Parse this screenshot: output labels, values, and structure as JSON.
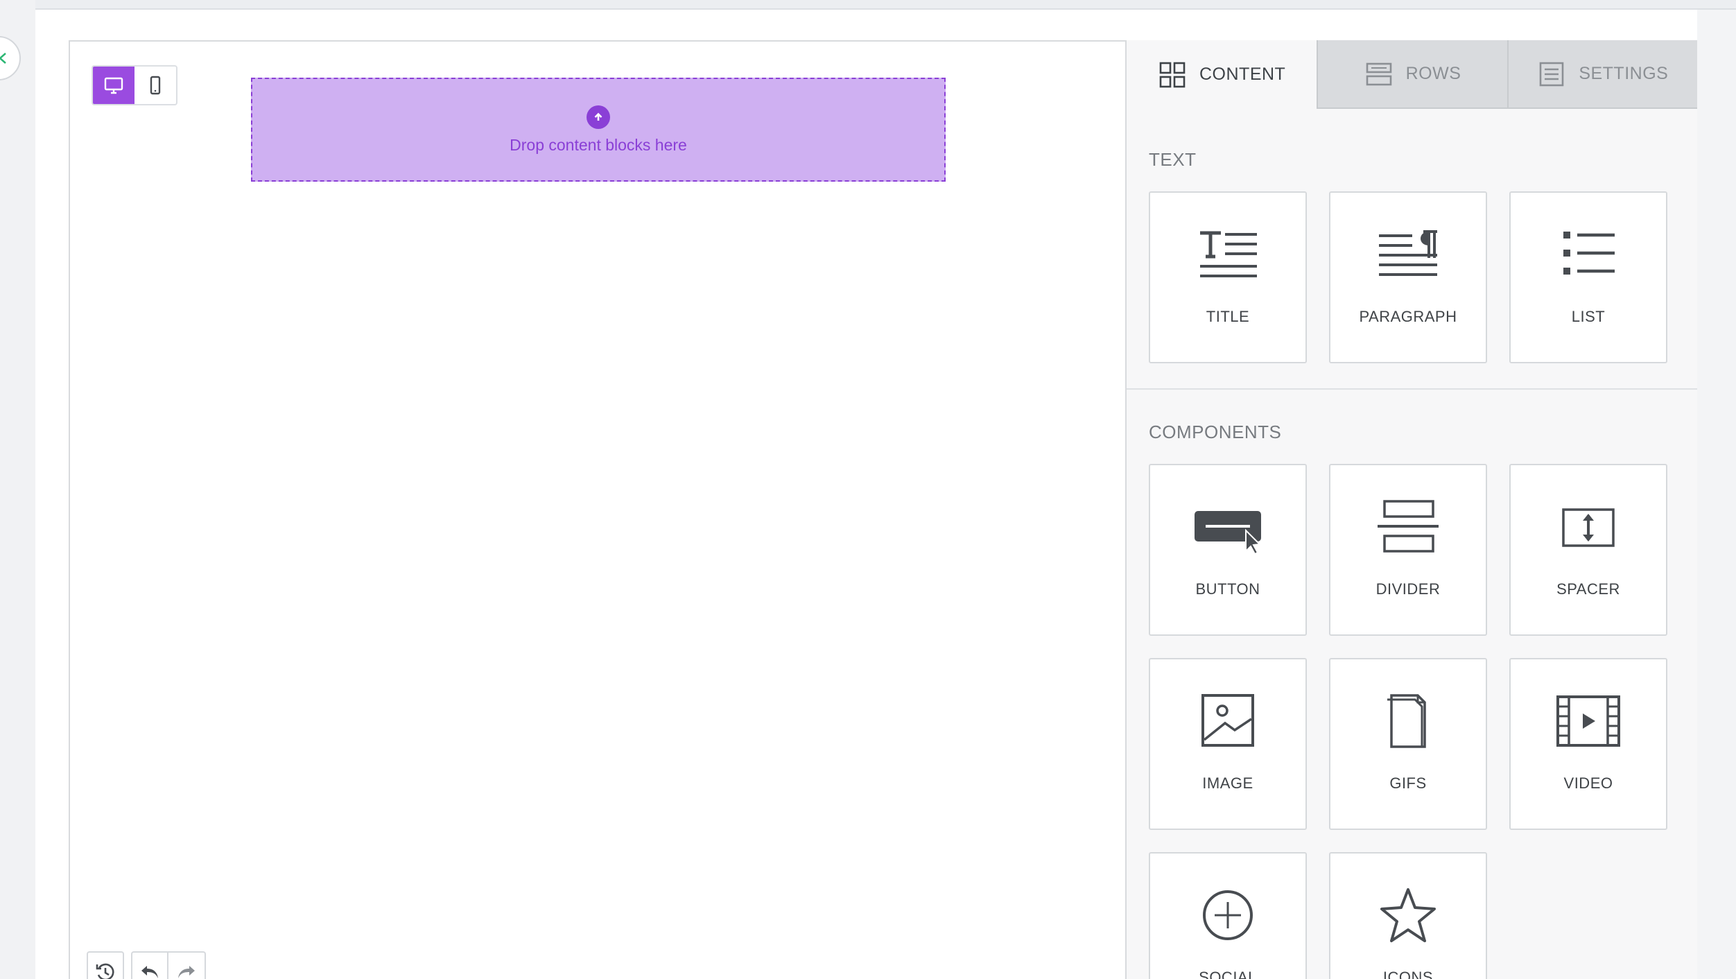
{
  "colors": {
    "accent": "#9a4be0",
    "dropzone_bg": "#cfb0f2",
    "dropzone_text": "#8a3fd6",
    "icon_dark": "#484c51"
  },
  "device_toggle": {
    "desktop_icon": "desktop-icon",
    "mobile_icon": "mobile-icon",
    "active": "desktop"
  },
  "dropzone": {
    "icon": "upload-arrow-icon",
    "text": "Drop content blocks here"
  },
  "history": {
    "history_icon": "history-icon",
    "undo_icon": "undo-icon",
    "redo_icon": "redo-icon"
  },
  "sidebar": {
    "tabs": [
      {
        "label": "CONTENT",
        "icon": "grid-icon",
        "active": true
      },
      {
        "label": "ROWS",
        "icon": "rows-icon",
        "active": false
      },
      {
        "label": "SETTINGS",
        "icon": "settings-icon",
        "active": false
      }
    ],
    "text_section": {
      "title": "TEXT",
      "blocks": [
        {
          "label": "TITLE",
          "icon": "title-icon"
        },
        {
          "label": "PARAGRAPH",
          "icon": "paragraph-icon"
        },
        {
          "label": "LIST",
          "icon": "list-icon"
        }
      ]
    },
    "components_section": {
      "title": "COMPONENTS",
      "blocks": [
        {
          "label": "BUTTON",
          "icon": "button-icon"
        },
        {
          "label": "DIVIDER",
          "icon": "divider-icon"
        },
        {
          "label": "SPACER",
          "icon": "spacer-icon"
        },
        {
          "label": "IMAGE",
          "icon": "image-icon"
        },
        {
          "label": "GIFS",
          "icon": "gifs-icon"
        },
        {
          "label": "VIDEO",
          "icon": "video-icon"
        },
        {
          "label": "SOCIAL",
          "icon": "social-icon"
        },
        {
          "label": "ICONS",
          "icon": "star-icon"
        }
      ]
    }
  }
}
